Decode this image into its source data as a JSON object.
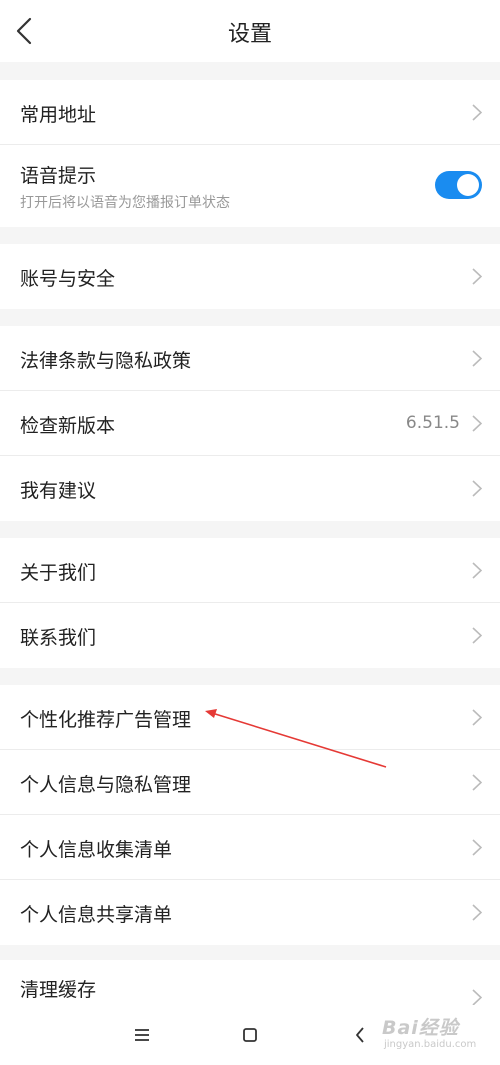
{
  "header": {
    "title": "设置",
    "back_icon": "chevron-left-icon"
  },
  "groups": [
    {
      "items": [
        {
          "label": "常用地址"
        },
        {
          "label": "语音提示",
          "sub": "打开后将以语音为您播报订单状态",
          "toggle_on": true
        }
      ]
    },
    {
      "items": [
        {
          "label": "账号与安全"
        }
      ]
    },
    {
      "items": [
        {
          "label": "法律条款与隐私政策"
        },
        {
          "label": "检查新版本",
          "value": "6.51.5"
        },
        {
          "label": "我有建议"
        }
      ]
    },
    {
      "items": [
        {
          "label": "关于我们"
        },
        {
          "label": "联系我们"
        }
      ]
    },
    {
      "items": [
        {
          "label": "个性化推荐广告管理"
        },
        {
          "label": "个人信息与隐私管理"
        },
        {
          "label": "个人信息收集清单"
        },
        {
          "label": "个人信息共享清单"
        }
      ]
    },
    {
      "items": [
        {
          "label": "清理缓存"
        }
      ]
    }
  ],
  "colors": {
    "toggle_on": "#1a8cf0",
    "arrow": "#e53935",
    "background": "#f5f5f5"
  },
  "system_nav": {
    "icons": [
      "menu-icon",
      "home-square-icon",
      "back-triangle-icon"
    ]
  },
  "watermark": {
    "top": "Bai经验",
    "bottom": "jingyan.baidu.com"
  }
}
